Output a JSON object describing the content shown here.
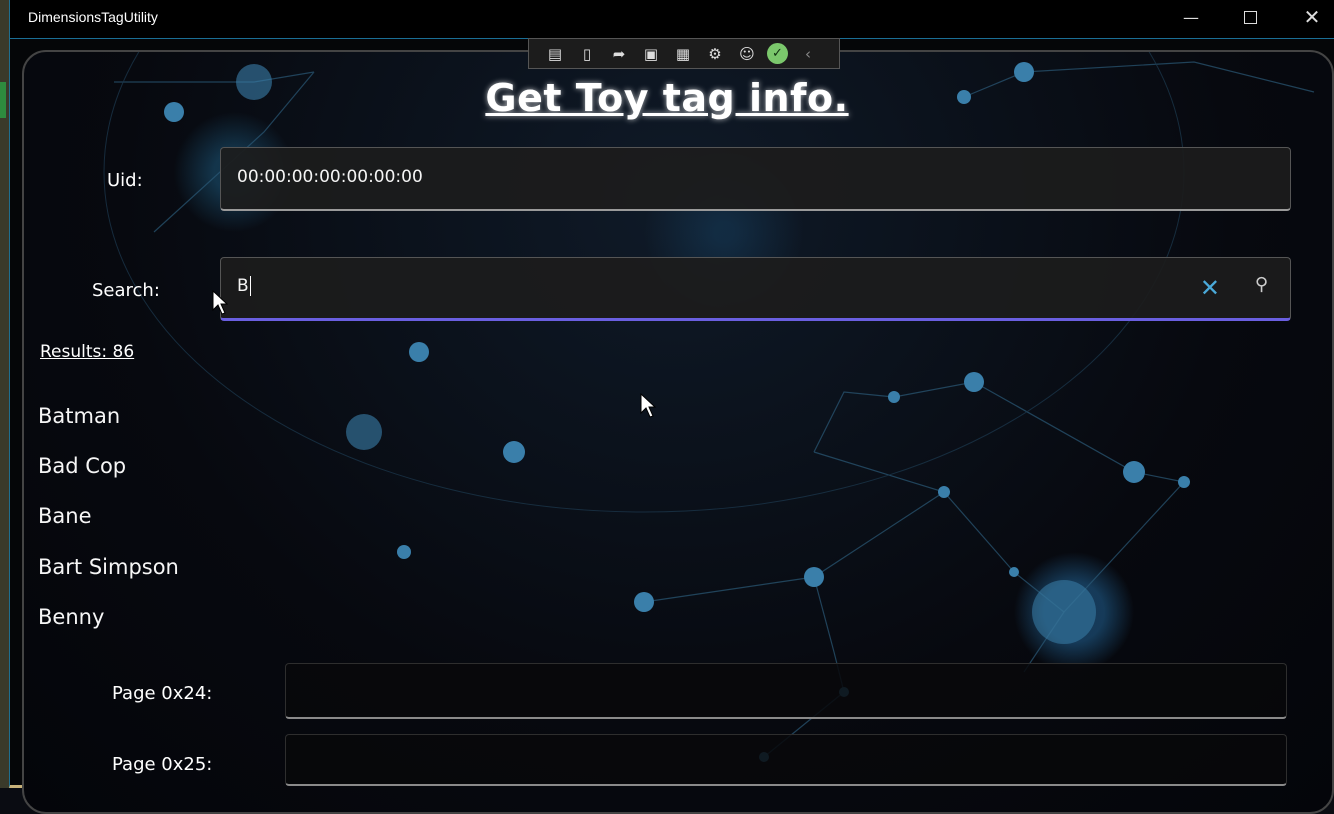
{
  "window": {
    "title": "DimensionsTagUtility"
  },
  "header": {
    "title": "Get Toy tag info."
  },
  "uid": {
    "label": "Uid:",
    "value": "00:00:00:00:00:00:00"
  },
  "search": {
    "label": "Search:",
    "value": "B"
  },
  "results": {
    "label": " Results: 86"
  },
  "list": {
    "items": [
      "Batman",
      "Bad Cop",
      "Bane",
      "Bart Simpson",
      "Benny"
    ]
  },
  "pages": [
    {
      "label": "Page 0x24:",
      "value": ""
    },
    {
      "label": "Page 0x25:",
      "value": ""
    }
  ],
  "icons": {
    "minimize": "minimize-icon",
    "maximize": "maximize-icon",
    "close": "close-icon",
    "clear": "clear-icon",
    "search": "search-icon"
  },
  "colors": {
    "accent": "#6a5fe0",
    "clear_icon": "#4aa9d9",
    "titlebar_border": "#1a6e95"
  }
}
